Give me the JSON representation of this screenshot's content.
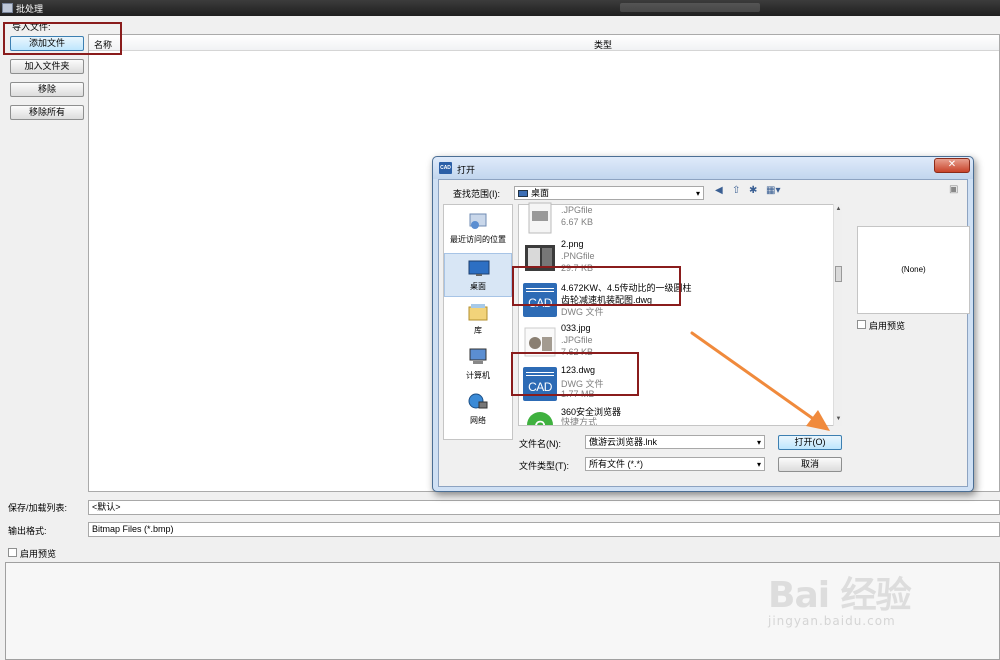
{
  "window": {
    "title": "批处理"
  },
  "import": {
    "label": "导入文件:",
    "buttons": [
      "添加文件",
      "加入文件夹",
      "移除",
      "移除所有"
    ]
  },
  "filelist": {
    "columns": [
      "名称",
      "类型"
    ]
  },
  "save_load": {
    "label": "保存/加载列表:",
    "value": "<默认>"
  },
  "output": {
    "label": "输出格式:",
    "value": "Bitmap Files (*.bmp)"
  },
  "preview": {
    "label": "启用预览"
  },
  "open_dialog": {
    "logo": "CAD",
    "title": "打开",
    "look_in_label": "查找范围(I):",
    "look_in_value": "桌面",
    "places": [
      "最近访问的位置",
      "桌面",
      "库",
      "计算机",
      "网络"
    ],
    "files": [
      {
        "name": "",
        "type": ".JPGfile",
        "size": "6.67 KB"
      },
      {
        "name": "2.png",
        "type": ".PNGfile",
        "size": "29.7 KB"
      },
      {
        "name": "4.672KW、4.5传动比的一级圆柱",
        "name2": "齿轮减速机装配图.dwg",
        "type": "DWG 文件",
        "size": ""
      },
      {
        "name": "033.jpg",
        "type": ".JPGfile",
        "size": "7.62 KB"
      },
      {
        "name": "123.dwg",
        "type": "DWG 文件",
        "size": "1.77 MB"
      },
      {
        "name": "360安全浏览器",
        "type": "快捷方式",
        "size": ""
      }
    ],
    "thumb_cad_text": "CAD",
    "preview_none": "(None)",
    "enable_preview": "启用预览",
    "filename_label": "文件名(N):",
    "filename_value": "傲游云浏览器.lnk",
    "filetype_label": "文件类型(T):",
    "filetype_value": "所有文件 (*.*)",
    "open_button": "打开(O)",
    "cancel_button": "取消"
  },
  "watermark": {
    "brand": "Bai 经验",
    "url": "jingyan.baidu.com"
  },
  "colors": {
    "highlight_box": "#8a1c1c",
    "arrow": "#f08a3c",
    "cad_blue": "#2d6bb5"
  }
}
